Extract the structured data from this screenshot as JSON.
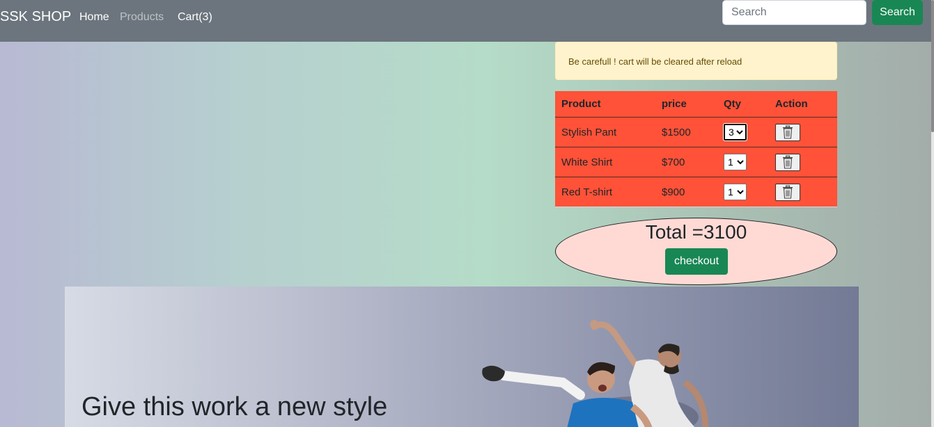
{
  "navbar": {
    "brand": "SSK SHOP",
    "links": [
      {
        "label": "Home"
      },
      {
        "label": "Products"
      },
      {
        "label": "Cart(3)"
      }
    ],
    "search": {
      "placeholder": "Search",
      "value": "",
      "button_label": "Search"
    },
    "background_color": "#6c757d"
  },
  "alert": {
    "message": "Be carefull ! cart will be cleared after reload",
    "background_color": "#fff3cd"
  },
  "cart": {
    "columns": [
      "Product",
      "price",
      "Qty",
      "Action"
    ],
    "rows": [
      {
        "product": "Stylish Pant",
        "price": "$1500",
        "qty": "3",
        "action_icon": "trash-icon"
      },
      {
        "product": "White Shirt",
        "price": "$700",
        "qty": "1",
        "action_icon": "trash-icon"
      },
      {
        "product": "Red T-shirt",
        "price": "$900",
        "qty": "1",
        "action_icon": "trash-icon"
      }
    ],
    "table_color": "#ff5238"
  },
  "summary": {
    "total_label": "Total =3100",
    "checkout_label": "checkout",
    "oval_color": "#ffdad5"
  },
  "hero": {
    "title": "Give this work a new style",
    "image": "football-players-image"
  },
  "colors": {
    "accent_green": "#198754"
  }
}
